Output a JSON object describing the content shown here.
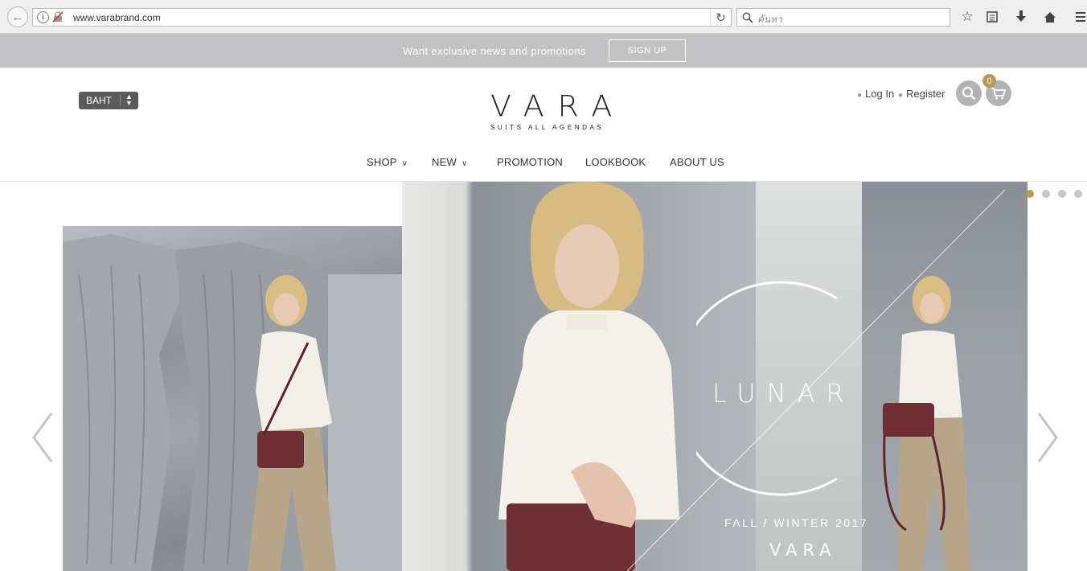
{
  "browser": {
    "url": "www.varabrand.com",
    "search_placeholder": "ค้นหา"
  },
  "promo": {
    "text": "Want exclusive news and promotions",
    "signup_label": "SIGN UP"
  },
  "header": {
    "currency": "BAHT",
    "logo_word": "VARA",
    "logo_tagline": "SUITS ALL AGENDAS",
    "login_label": "Log In",
    "register_label": "Register",
    "cart_count": "0",
    "accent_color": "#b89a54"
  },
  "menu": {
    "shop": "SHOP",
    "new": "NEW",
    "promotion": "PROMOTION",
    "lookbook": "LOOKBOOK",
    "about": "ABOUT US"
  },
  "hero": {
    "collection": "LUNAR",
    "season": "FALL / WINTER 2017",
    "brand": "VARA",
    "slide_count": 4,
    "active_slide": 1
  },
  "icons": [
    "back-arrow-icon",
    "info-icon",
    "lock-icon",
    "reload-icon",
    "search-icon",
    "star-icon",
    "reading-list-icon",
    "download-icon",
    "home-icon",
    "menu-icon",
    "cart-icon",
    "chevron-down-icon",
    "chevron-left-icon",
    "chevron-right-icon"
  ]
}
